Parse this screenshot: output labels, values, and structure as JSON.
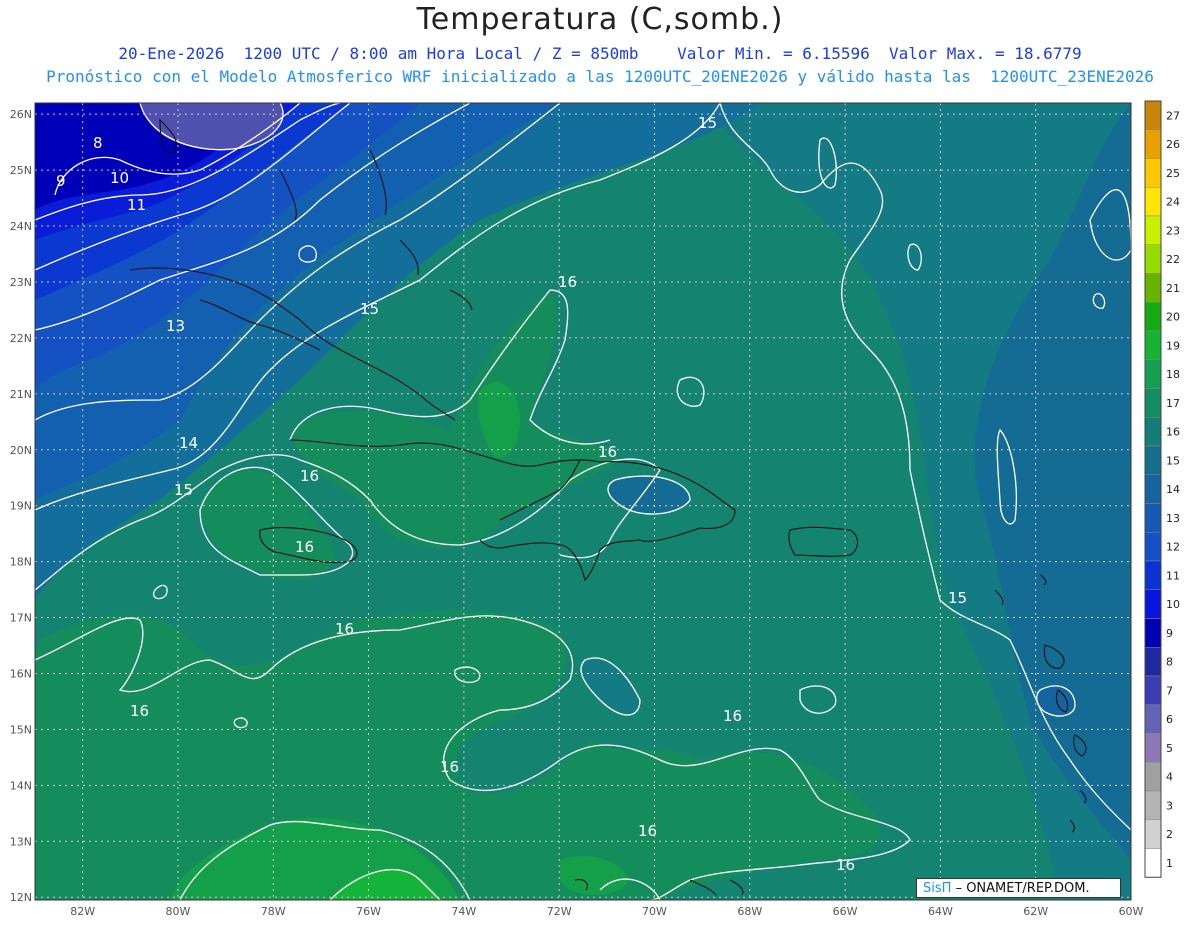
{
  "header": {
    "title": "Temperatura (C,somb.)",
    "line1": "20-Ene-2026  1200 UTC / 8:00 am Hora Local / Z = 850mb    Valor Min. = 6.15596  Valor Max. = 18.6779",
    "line2": "Pronóstico con el Modelo Atmosferico WRF inicializado a las 1200UTC_20ENE2026 y válido hasta las  1200UTC_23ENE2026"
  },
  "axes": {
    "lat_labels": [
      "26N",
      "25N",
      "24N",
      "23N",
      "22N",
      "21N",
      "20N",
      "19N",
      "18N",
      "17N",
      "16N",
      "15N",
      "14N",
      "13N",
      "12N"
    ],
    "lon_labels": [
      "82W",
      "80W",
      "78W",
      "76W",
      "74W",
      "72W",
      "70W",
      "68W",
      "66W",
      "64W",
      "62W",
      "60W"
    ]
  },
  "contour_labels": [
    {
      "text": "8"
    },
    {
      "text": "9"
    },
    {
      "text": "10"
    },
    {
      "text": "11"
    },
    {
      "text": "13"
    },
    {
      "text": "14"
    },
    {
      "text": "15"
    },
    {
      "text": "15"
    },
    {
      "text": "15"
    },
    {
      "text": "15"
    },
    {
      "text": "16"
    },
    {
      "text": "16"
    },
    {
      "text": "16"
    },
    {
      "text": "16"
    },
    {
      "text": "16"
    },
    {
      "text": "16"
    },
    {
      "text": "16"
    },
    {
      "text": "16"
    },
    {
      "text": "16"
    },
    {
      "text": "16"
    }
  ],
  "colorbar": {
    "labels": [
      "27",
      "26",
      "25",
      "24",
      "23",
      "22",
      "21",
      "20",
      "19",
      "18",
      "17",
      "16",
      "15",
      "14",
      "13",
      "12",
      "11",
      "10",
      "9",
      "8",
      "7",
      "6",
      "5",
      "4",
      "3",
      "2",
      "1"
    ],
    "colors": [
      "#c8860a",
      "#e6a000",
      "#ffc800",
      "#ffe600",
      "#c8f000",
      "#96dc00",
      "#64b400",
      "#14aa14",
      "#14b432",
      "#14a050",
      "#148c64",
      "#147d78",
      "#146e8c",
      "#1464a0",
      "#145ab4",
      "#1450c8",
      "#0a32d2",
      "#0a14dc",
      "#0000b4",
      "#1e28a0",
      "#3c3cb4",
      "#6464b4",
      "#8c78b4",
      "#a0a0a0",
      "#b4b4b4",
      "#d2d2d2",
      "#ffffff"
    ]
  },
  "credit": {
    "brand": "SisΠ",
    "text": "– ONAMET/REP.DOM."
  }
}
